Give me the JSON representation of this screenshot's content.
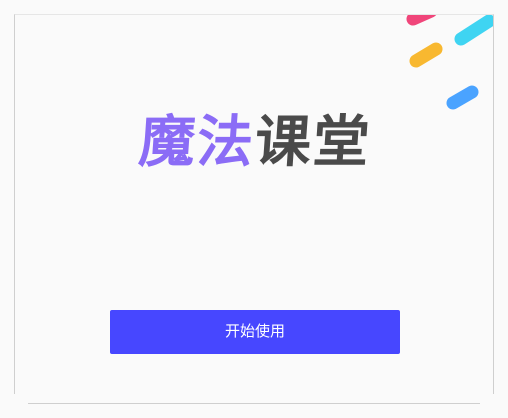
{
  "app": {
    "logo_part1": "魔法",
    "logo_part2": "课堂"
  },
  "main": {
    "start_label": "开始使用"
  },
  "colors": {
    "accent": "#4747ff",
    "logo_purple": "#8b6cf6",
    "logo_dark": "#4a4a4a",
    "stripe_pink": "#f0457a",
    "stripe_cyan": "#3fd4f2",
    "stripe_yellow": "#f8b830",
    "stripe_blue": "#4aa3ff"
  },
  "decorations": [
    {
      "name": "pink-stripe",
      "color_key": "stripe_pink"
    },
    {
      "name": "cyan-stripe",
      "color_key": "stripe_cyan"
    },
    {
      "name": "yellow-stripe",
      "color_key": "stripe_yellow"
    },
    {
      "name": "blue-stripe",
      "color_key": "stripe_blue"
    }
  ]
}
